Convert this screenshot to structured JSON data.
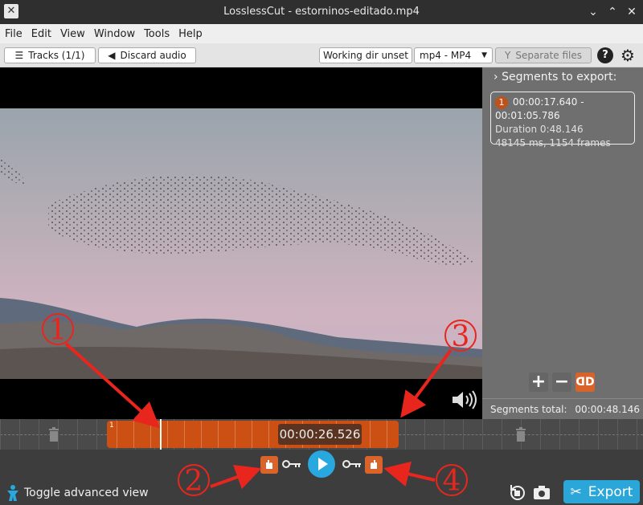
{
  "window": {
    "title": "LosslessCut - estorninos-editado.mp4",
    "controls": [
      "chevron-down",
      "chevron-up",
      "close"
    ]
  },
  "menu": [
    "File",
    "Edit",
    "View",
    "Window",
    "Tools",
    "Help"
  ],
  "toolbar": {
    "tracks_label": "Tracks (1/1)",
    "discard_audio_label": "Discard audio",
    "working_dir_label": "Working dir unset",
    "format_label": "mp4 - MP4",
    "separate_files_label": "Separate files",
    "help_label": "?"
  },
  "panel": {
    "heading": "Segments to export:",
    "segments": [
      {
        "number": "1",
        "range": "00:00:17.640 - 00:01:05.786",
        "duration": "Duration 0:48.146",
        "details": "48145 ms, 1154 frames"
      }
    ],
    "total_label": "Segments total:",
    "total_value": "00:00:48.146"
  },
  "timeline": {
    "current_time": "00:00:26.526",
    "segment_label": "1"
  },
  "bottom": {
    "toggle_advanced_label": "Toggle advanced view",
    "export_label": "Export"
  },
  "annotations": [
    "1",
    "2",
    "3",
    "4"
  ],
  "colors": {
    "accent": "#2ba6d8",
    "segment": "#cc4f14",
    "annotation": "#e8261e"
  }
}
